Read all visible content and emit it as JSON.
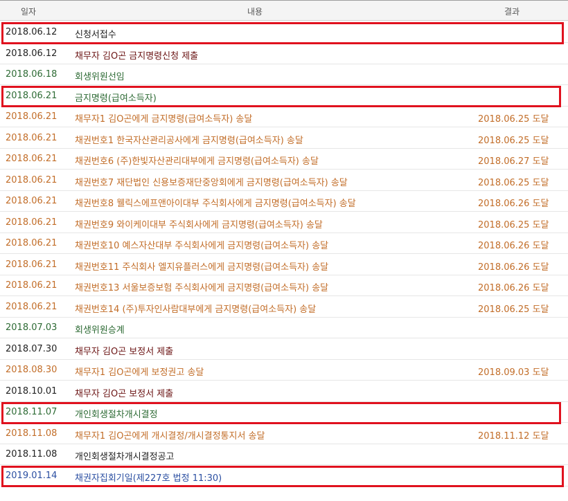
{
  "header": {
    "date": "일자",
    "content": "내용",
    "result": "결과"
  },
  "rows": [
    {
      "date": "2018.06.12",
      "content": "신청서접수",
      "result": "",
      "color": "black"
    },
    {
      "date": "2018.06.12",
      "content": "채무자 김O곤 금지명령신청 제출",
      "result": "",
      "color": "maroon"
    },
    {
      "date": "2018.06.18",
      "content": "회생위원선임",
      "result": "",
      "color": "green"
    },
    {
      "date": "2018.06.21",
      "content": "금지명령(급여소득자)",
      "result": "",
      "color": "green"
    },
    {
      "date": "2018.06.21",
      "content": "채무자1 김O곤에게 금지명령(급여소득자) 송달",
      "result": "2018.06.25 도달",
      "color": "orange"
    },
    {
      "date": "2018.06.21",
      "content": "채권번호1 한국자산관리공사에게 금지명령(급여소득자) 송달",
      "result": "2018.06.25 도달",
      "color": "orange"
    },
    {
      "date": "2018.06.21",
      "content": "채권번호6 (주)한빛자산관리대부에게 금지명령(급여소득자) 송달",
      "result": "2018.06.27 도달",
      "color": "orange"
    },
    {
      "date": "2018.06.21",
      "content": "채권번호7 재단법인 신용보증재단중앙회에게 금지명령(급여소득자) 송달",
      "result": "2018.06.25 도달",
      "color": "orange"
    },
    {
      "date": "2018.06.21",
      "content": "채권번호8 웰릭스에프앤아이대부 주식회사에게 금지명령(급여소득자) 송달",
      "result": "2018.06.26 도달",
      "color": "orange"
    },
    {
      "date": "2018.06.21",
      "content": "채권번호9 와이케이대부 주식회사에게 금지명령(급여소득자) 송달",
      "result": "2018.06.25 도달",
      "color": "orange"
    },
    {
      "date": "2018.06.21",
      "content": "채권번호10 예스자산대부 주식회사에게 금지명령(급여소득자) 송달",
      "result": "2018.06.26 도달",
      "color": "orange"
    },
    {
      "date": "2018.06.21",
      "content": "채권번호11 주식회사 엘지유플러스에게 금지명령(급여소득자) 송달",
      "result": "2018.06.26 도달",
      "color": "orange"
    },
    {
      "date": "2018.06.21",
      "content": "채권번호13 서울보증보험 주식회사에게 금지명령(급여소득자) 송달",
      "result": "2018.06.26 도달",
      "color": "orange"
    },
    {
      "date": "2018.06.21",
      "content": "채권번호14 (주)투자인사람대부에게 금지명령(급여소득자) 송달",
      "result": "2018.06.25 도달",
      "color": "orange"
    },
    {
      "date": "2018.07.03",
      "content": "회생위원승계",
      "result": "",
      "color": "green"
    },
    {
      "date": "2018.07.30",
      "content": "채무자 김O곤 보정서 제출",
      "result": "",
      "color": "maroon"
    },
    {
      "date": "2018.08.30",
      "content": "채무자1 김O곤에게 보정권고 송달",
      "result": "2018.09.03 도달",
      "color": "orange"
    },
    {
      "date": "2018.10.01",
      "content": "채무자 김O곤 보정서 제출",
      "result": "",
      "color": "maroon"
    },
    {
      "date": "2018.11.07",
      "content": "개인회생절차개시결정",
      "result": "",
      "color": "green"
    },
    {
      "date": "2018.11.08",
      "content": "채무자1 김O곤에게 개시결정/개시결정통지서 송달",
      "result": "2018.11.12 도달",
      "color": "orange"
    },
    {
      "date": "2018.11.08",
      "content": "개인회생절차개시결정공고",
      "result": "",
      "color": "black"
    },
    {
      "date": "2019.01.14",
      "content": "채권자집회기일(제227호 법정 11:30)",
      "result": "",
      "color": "blue"
    }
  ],
  "highlighted_rows": [
    0,
    3,
    18,
    21
  ],
  "colors": {
    "highlight": "#e0111e",
    "black": "#222222",
    "maroon": "#6b1414",
    "green": "#2e6b35",
    "orange": "#c26d28",
    "blue": "#2a4ea1"
  }
}
